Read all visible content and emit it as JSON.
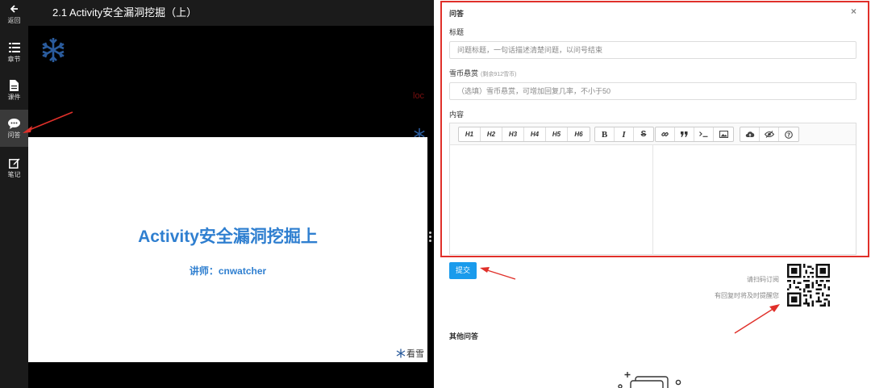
{
  "sidebar": {
    "items": [
      {
        "label": "返回",
        "icon": "back-arrow-icon"
      },
      {
        "label": "章节",
        "icon": "list-icon"
      },
      {
        "label": "课件",
        "icon": "document-icon"
      },
      {
        "label": "问答",
        "icon": "chat-bubble-icon",
        "active": true
      },
      {
        "label": "笔记",
        "icon": "edit-note-icon"
      }
    ]
  },
  "header": {
    "title": "2.1 Activity安全漏洞挖掘（上）"
  },
  "video": {
    "slide_title": "Activity安全漏洞挖掘上",
    "slide_subtitle": "讲师：cnwatcher",
    "slide_logo": "看雪",
    "red_text": "loc"
  },
  "qa_panel": {
    "title": "问答",
    "close": "×",
    "title_label": "标题",
    "title_placeholder": "问题标题，一句话描述清楚问题，以问号结束",
    "bounty_label": "雪币悬赏",
    "bounty_note": "(剩余912雪币)",
    "bounty_placeholder": "（选填）雪币悬赏，可增加回复几率，不小于50",
    "content_label": "内容",
    "toolbar": {
      "headings": [
        "H1",
        "H2",
        "H3",
        "H4",
        "H5",
        "H6"
      ],
      "format": [
        "B",
        "I",
        "S"
      ],
      "insert": [
        "link",
        "quote",
        "code",
        "image"
      ],
      "view": [
        "upload",
        "preview",
        "help"
      ]
    }
  },
  "submit_label": "提交",
  "qr": {
    "line1": "请扫码订阅",
    "line2": "有回复时将及时提醒您"
  },
  "other_title": "其他问答",
  "colors": {
    "accent": "#1a9bec",
    "highlight_border": "#e0302a",
    "slide_text": "#2f7fd0"
  }
}
